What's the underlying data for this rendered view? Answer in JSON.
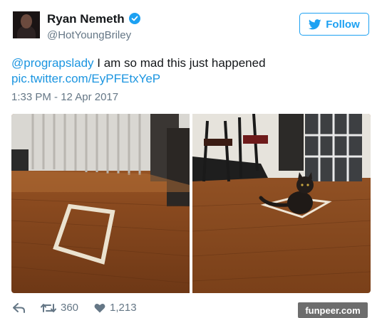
{
  "tweet": {
    "author_name": "Ryan Nemeth",
    "author_handle": "@HotYoungBriley",
    "follow_label": "Follow",
    "mention": "@prograpslady",
    "text": " I am so mad this just happened",
    "media_link": "pic.twitter.com/EyPFEtxYeP",
    "timestamp": "1:33 PM - 12 Apr 2017",
    "retweet_count": "360",
    "like_count": "1,213"
  },
  "watermark": "funpeer.com",
  "colors": {
    "accent": "#1da1f2",
    "link": "#1b95e0",
    "muted": "#657786"
  },
  "icons": {
    "verified": "verified-badge-icon",
    "bird": "twitter-bird-icon",
    "reply": "reply-icon",
    "retweet": "retweet-icon",
    "like": "heart-icon"
  }
}
